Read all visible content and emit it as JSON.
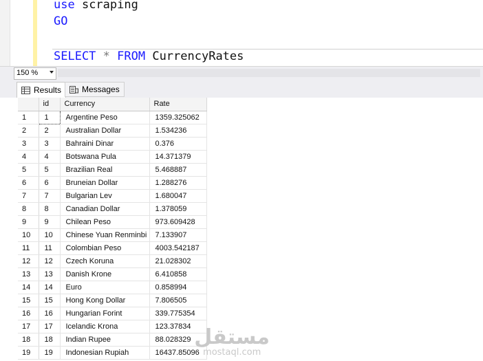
{
  "editor": {
    "line1_keyword": "use",
    "line1_rest": " scraping",
    "line2": "GO",
    "line3_select": "SELECT",
    "line3_star": " * ",
    "line3_from": "FROM",
    "line3_table": " CurrencyRates"
  },
  "zoom": {
    "value": "150 %"
  },
  "tabs": {
    "results": "Results",
    "messages": "Messages"
  },
  "grid": {
    "columns": [
      "",
      "id",
      "Currency",
      "Rate"
    ],
    "rows": [
      [
        "1",
        "1",
        "Argentine Peso",
        "1359.325062"
      ],
      [
        "2",
        "2",
        "Australian Dollar",
        "1.534236"
      ],
      [
        "3",
        "3",
        "Bahraini Dinar",
        "0.376"
      ],
      [
        "4",
        "4",
        "Botswana Pula",
        "14.371379"
      ],
      [
        "5",
        "5",
        "Brazilian Real",
        "5.468887"
      ],
      [
        "6",
        "6",
        "Bruneian Dollar",
        "1.288276"
      ],
      [
        "7",
        "7",
        "Bulgarian Lev",
        "1.680047"
      ],
      [
        "8",
        "8",
        "Canadian Dollar",
        "1.378059"
      ],
      [
        "9",
        "9",
        "Chilean Peso",
        "973.609428"
      ],
      [
        "10",
        "10",
        "Chinese Yuan Renminbi",
        "7.133907"
      ],
      [
        "11",
        "11",
        "Colombian Peso",
        "4003.542187"
      ],
      [
        "12",
        "12",
        "Czech Koruna",
        "21.028302"
      ],
      [
        "13",
        "13",
        "Danish Krone",
        "6.410858"
      ],
      [
        "14",
        "14",
        "Euro",
        "0.858994"
      ],
      [
        "15",
        "15",
        "Hong Kong Dollar",
        "7.806505"
      ],
      [
        "16",
        "16",
        "Hungarian Forint",
        "339.775354"
      ],
      [
        "17",
        "17",
        "Icelandic Krona",
        "123.37834"
      ],
      [
        "18",
        "18",
        "Indian Rupee",
        "88.028329"
      ],
      [
        "19",
        "19",
        "Indonesian Rupiah",
        "16437.85096"
      ]
    ]
  },
  "watermark": {
    "arabic": "مستقل",
    "latin": "mostaql.com"
  },
  "colors": {
    "keyword": "#1a1aff",
    "gutter": "#fff2a6",
    "toolbar": "#eeeef2"
  }
}
